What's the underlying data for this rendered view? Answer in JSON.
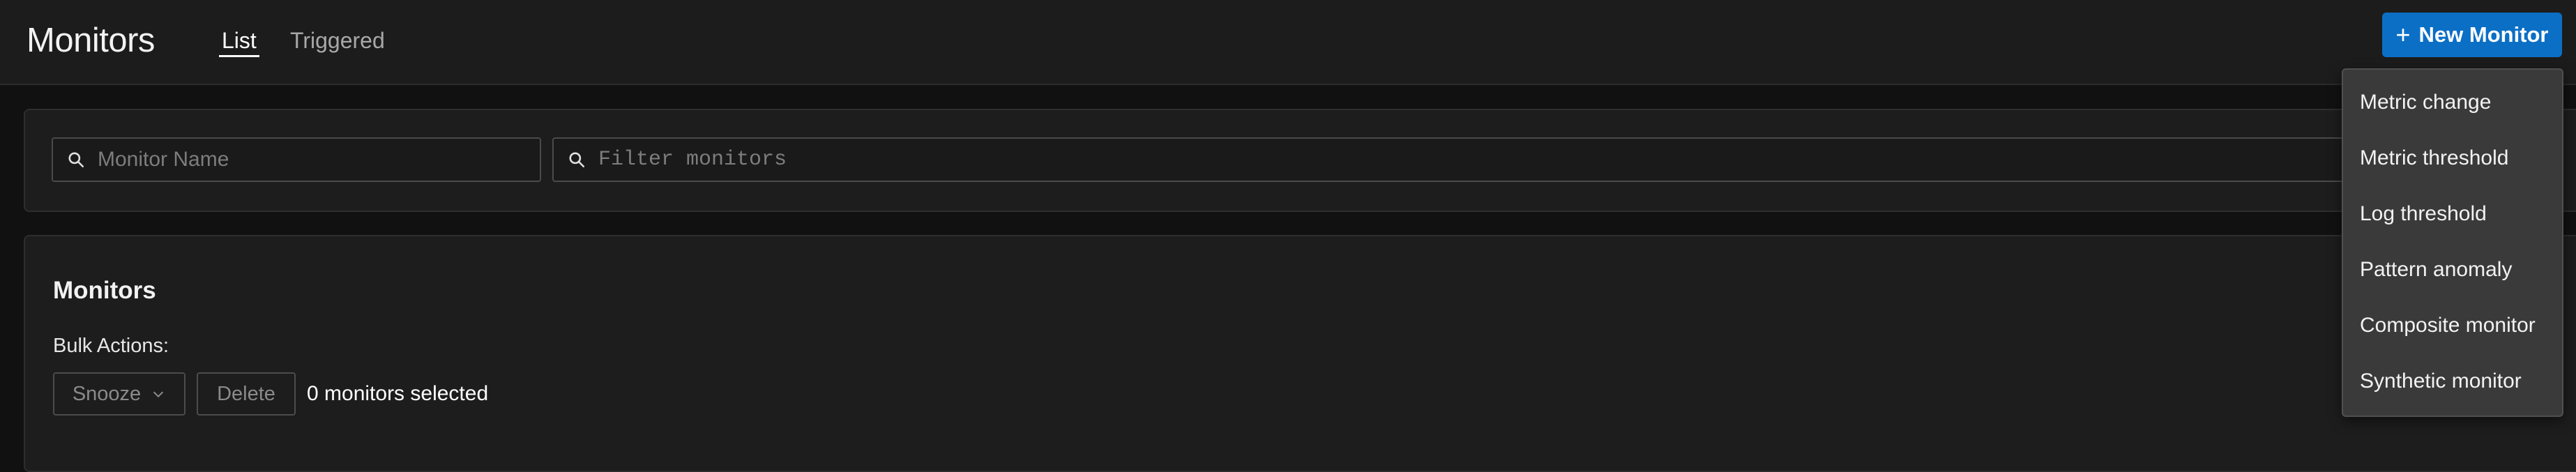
{
  "header": {
    "title": "Monitors",
    "tabs": [
      {
        "label": "List",
        "active": true
      },
      {
        "label": "Triggered",
        "active": false
      }
    ],
    "new_button_label": "New Monitor",
    "new_button_icon": "plus-icon",
    "accent_color": "#0b6fc5"
  },
  "filters": {
    "name_search": {
      "placeholder": "Monitor Name",
      "value": "",
      "icon": "search-icon"
    },
    "filter_search": {
      "placeholder": "Filter monitors",
      "value": "",
      "icon": "search-icon"
    }
  },
  "monitors": {
    "title": "Monitors",
    "bulk_actions_label": "Bulk Actions:",
    "snooze_label": "Snooze",
    "delete_label": "Delete",
    "selected_text": "0 monitors selected"
  },
  "new_monitor_menu": {
    "items": [
      {
        "label": "Metric change"
      },
      {
        "label": "Metric threshold"
      },
      {
        "label": "Log threshold"
      },
      {
        "label": "Pattern anomaly"
      },
      {
        "label": "Composite monitor"
      },
      {
        "label": "Synthetic monitor"
      }
    ]
  }
}
